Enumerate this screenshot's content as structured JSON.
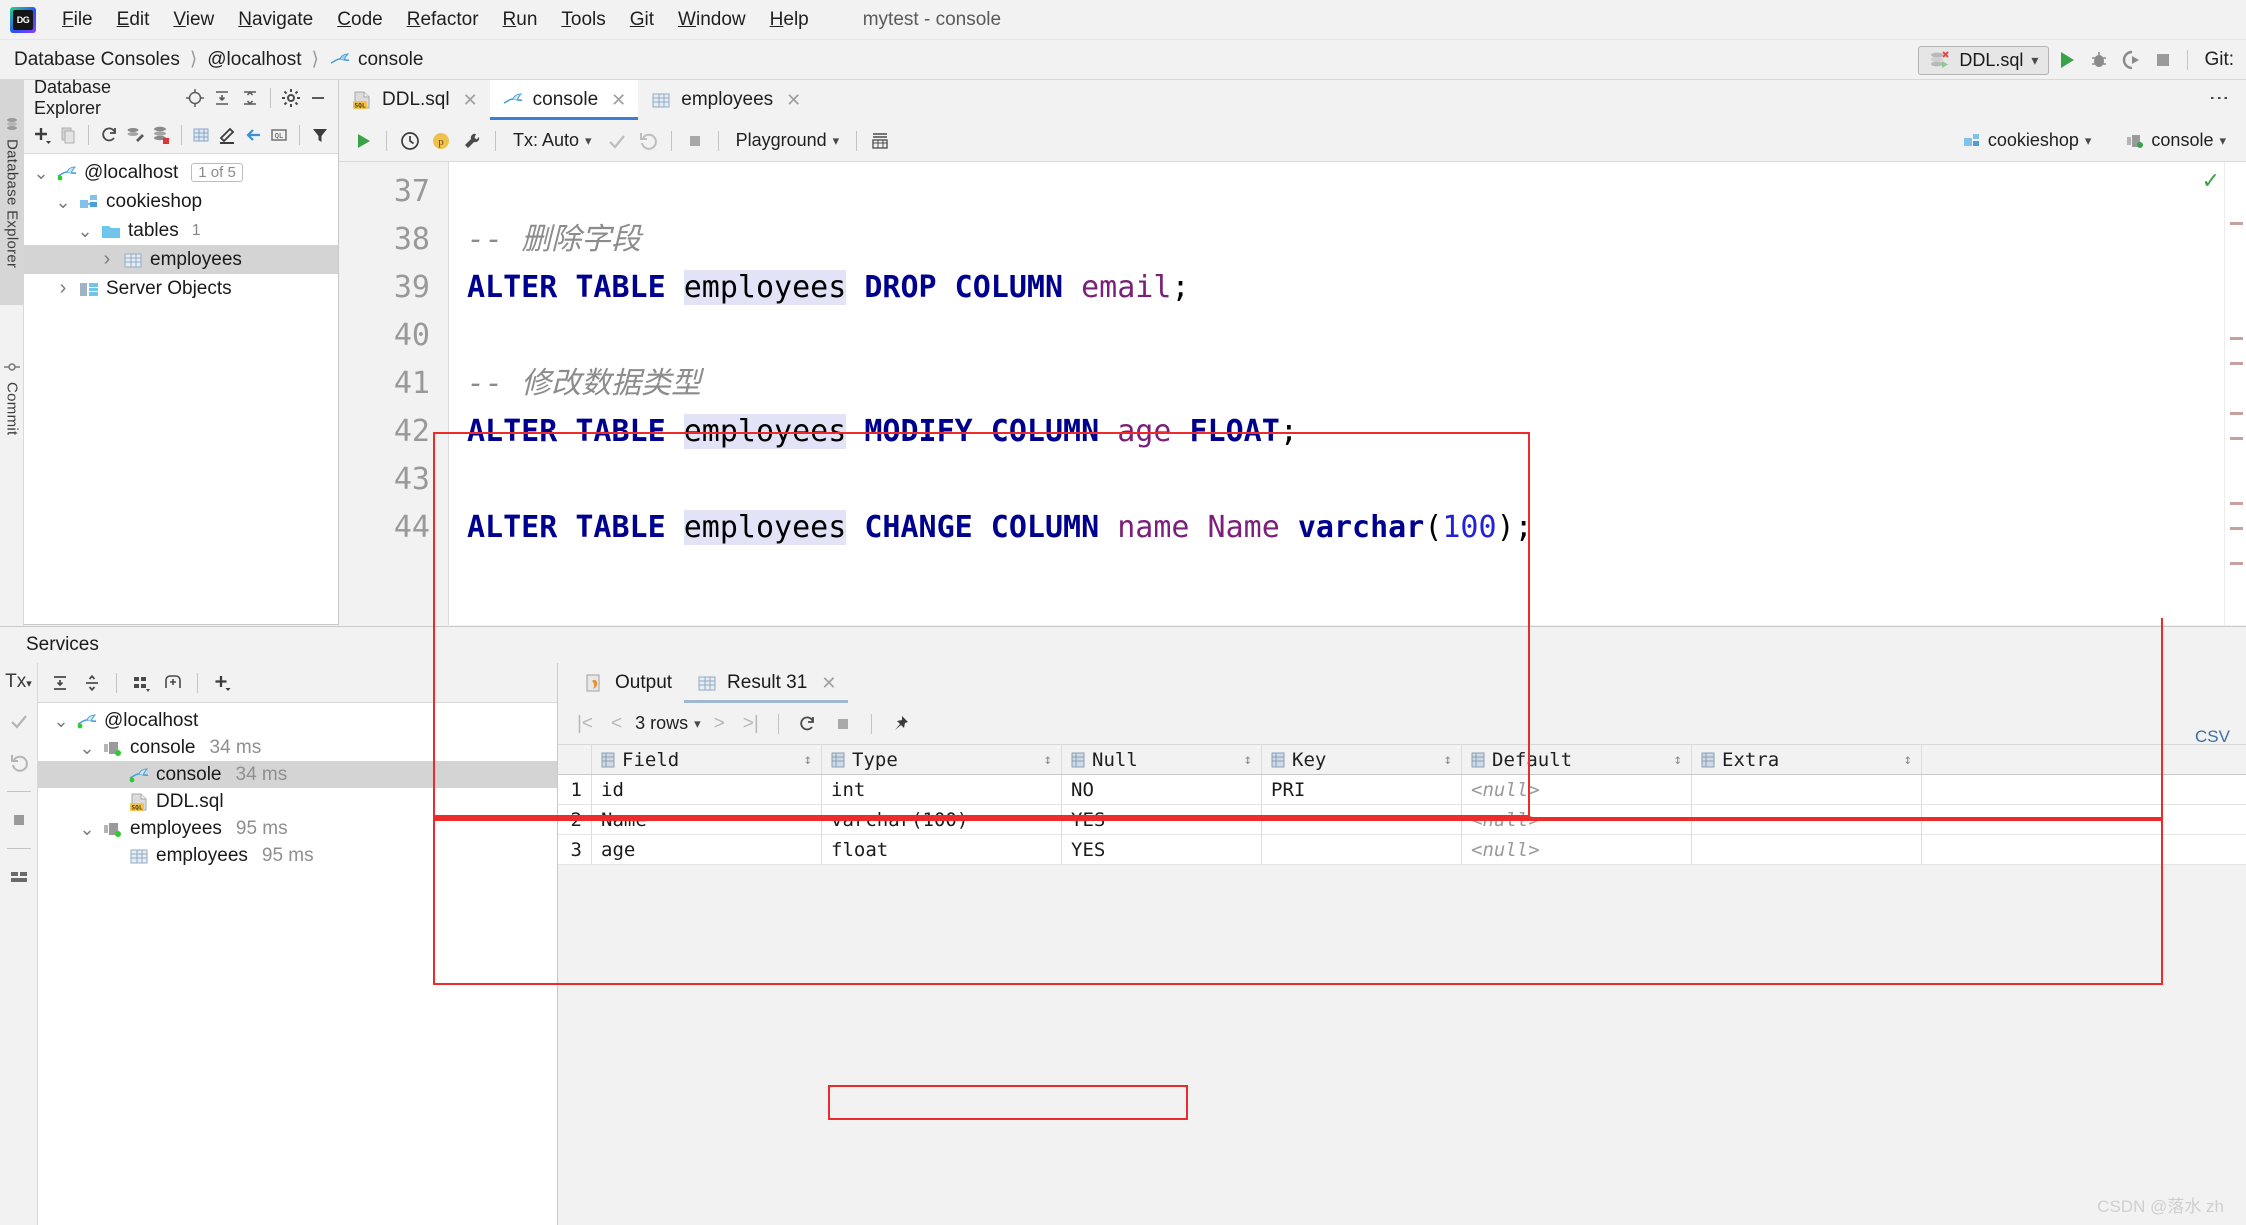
{
  "window": {
    "title": "mytest - console"
  },
  "menu": {
    "items": [
      "File",
      "Edit",
      "View",
      "Navigate",
      "Code",
      "Refactor",
      "Run",
      "Tools",
      "Git",
      "Window",
      "Help"
    ]
  },
  "breadcrumb": {
    "items": [
      "Database Consoles",
      "@localhost",
      "console"
    ]
  },
  "navbar_right": {
    "run_config": "DDL.sql",
    "git_label": "Git:",
    "icons": [
      "run-icon",
      "debug-icon",
      "run-with-coverage-icon",
      "stop-icon"
    ]
  },
  "left_strip": {
    "tabs": [
      "Database Explorer",
      "Commit"
    ]
  },
  "db_explorer": {
    "title": "Database Explorer",
    "header_icons": [
      "locate-icon",
      "expand-all-icon",
      "collapse-all-icon",
      "settings-icon",
      "hide-icon"
    ],
    "toolbar_icons": [
      "add-icon",
      "copy-icon",
      "refresh-icon",
      "modify-icon",
      "datasource-properties-icon",
      "table-editor-icon",
      "edit-icon",
      "jump-to-icon",
      "query-console-icon",
      "filter-icon"
    ],
    "tree": [
      {
        "label": "@localhost",
        "badge": "1 of 5",
        "icon": "mysql-icon",
        "depth": 0,
        "expanded": true,
        "selected": false
      },
      {
        "label": "cookieshop",
        "badge": "",
        "icon": "schema-icon",
        "depth": 1,
        "expanded": true,
        "selected": false
      },
      {
        "label": "tables",
        "badge": "",
        "count": "1",
        "icon": "folder-icon",
        "depth": 2,
        "expanded": true,
        "selected": false
      },
      {
        "label": "employees",
        "badge": "",
        "icon": "table-icon",
        "depth": 3,
        "expanded": false,
        "selected": true
      },
      {
        "label": "Server Objects",
        "badge": "",
        "icon": "server-objects-icon",
        "depth": 1,
        "expanded": false,
        "selected": false
      }
    ]
  },
  "editor": {
    "tabs": [
      {
        "label": "DDL.sql",
        "icon": "sql-file-icon",
        "active": false,
        "closable": true
      },
      {
        "label": "console",
        "icon": "mysql-console-icon",
        "active": true,
        "closable": true
      },
      {
        "label": "employees",
        "icon": "table-icon",
        "active": false,
        "closable": true
      }
    ],
    "toolbar": {
      "tx_label": "Tx: Auto",
      "schema_label": "Playground",
      "icons": [
        "execute-icon",
        "history-icon",
        "parameters-icon",
        "wrench-icon",
        "commit-icon",
        "rollback-icon",
        "stop-icon",
        "output-layout-icon"
      ]
    },
    "context": {
      "database": "cookieshop",
      "session": "console"
    },
    "gutter_lines": [
      "37",
      "38",
      "39",
      "40",
      "41",
      "42",
      "43",
      "44"
    ],
    "lines": [
      {
        "n": "37",
        "tokens": []
      },
      {
        "n": "38",
        "tokens": [
          {
            "t": "comment",
            "v": "-- 删除字段"
          }
        ]
      },
      {
        "n": "39",
        "tokens": [
          {
            "t": "kw",
            "v": "ALTER TABLE "
          },
          {
            "t": "tbl",
            "v": "employees"
          },
          {
            "t": "kw",
            "v": " DROP COLUMN "
          },
          {
            "t": "col",
            "v": "email"
          },
          {
            "t": "punc",
            "v": ";"
          }
        ]
      },
      {
        "n": "40",
        "tokens": []
      },
      {
        "n": "41",
        "tokens": [
          {
            "t": "comment",
            "v": "-- 修改数据类型"
          }
        ]
      },
      {
        "n": "42",
        "tokens": [
          {
            "t": "kw",
            "v": "ALTER TABLE "
          },
          {
            "t": "tbl",
            "v": "employees"
          },
          {
            "t": "kw",
            "v": " MODIFY COLUMN "
          },
          {
            "t": "col",
            "v": "age"
          },
          {
            "t": "kw",
            "v": " FLOAT"
          },
          {
            "t": "punc",
            "v": ";"
          }
        ]
      },
      {
        "n": "43",
        "tokens": []
      },
      {
        "n": "44",
        "tokens": [
          {
            "t": "kw",
            "v": "ALTER TABLE "
          },
          {
            "t": "tbl",
            "v": "employees"
          },
          {
            "t": "kw",
            "v": " CHANGE COLUMN "
          },
          {
            "t": "col",
            "v": "name Name"
          },
          {
            "t": "kw",
            "v": " varchar"
          },
          {
            "t": "punc",
            "v": "("
          },
          {
            "t": "num",
            "v": "100"
          },
          {
            "t": "punc",
            "v": ");"
          }
        ]
      }
    ]
  },
  "services": {
    "title": "Services",
    "strip_icons": [
      "Tx",
      "commit-icon",
      "rollback-icon",
      "stop-icon",
      "layout-icon"
    ],
    "toolbar_icons": [
      "expand-all-icon",
      "collapse-all-icon",
      "group-icon",
      "add-tab-icon",
      "add-icon"
    ],
    "tree": [
      {
        "label": "@localhost",
        "time": "",
        "icon": "mysql-icon",
        "depth": 0,
        "expanded": true,
        "selected": false
      },
      {
        "label": "console",
        "time": "34 ms",
        "icon": "session-icon",
        "depth": 1,
        "expanded": true,
        "selected": false
      },
      {
        "label": "console",
        "time": "34 ms",
        "icon": "mysql-icon",
        "depth": 2,
        "expanded": null,
        "selected": true
      },
      {
        "label": "DDL.sql",
        "time": "",
        "icon": "sql-file-icon",
        "depth": 2,
        "expanded": null,
        "selected": false
      },
      {
        "label": "employees",
        "time": "95 ms",
        "icon": "session-icon",
        "depth": 1,
        "expanded": true,
        "selected": false
      },
      {
        "label": "employees",
        "time": "95 ms",
        "icon": "table-icon",
        "depth": 2,
        "expanded": null,
        "selected": false
      }
    ]
  },
  "results": {
    "tabs": [
      {
        "label": "Output",
        "icon": "output-icon",
        "active": false,
        "closable": false
      },
      {
        "label": "Result 31",
        "icon": "table-icon",
        "active": true,
        "closable": true
      }
    ],
    "toolbar": {
      "first_page": "|<",
      "prev_page": "<",
      "rows_label": "3 rows",
      "next_page": ">",
      "last_page": ">|",
      "icons": [
        "reload-icon",
        "stop-icon",
        "pin-icon"
      ]
    },
    "export_label": "CSV",
    "columns": [
      "Field",
      "Type",
      "Null",
      "Key",
      "Default",
      "Extra"
    ],
    "rows": [
      {
        "n": "1",
        "Field": "id",
        "Type": "int",
        "Null": "NO",
        "Key": "PRI",
        "Default": "<null>",
        "Extra": ""
      },
      {
        "n": "2",
        "Field": "Name",
        "Type": "varchar(100)",
        "Null": "YES",
        "Key": "",
        "Default": "<null>",
        "Extra": ""
      },
      {
        "n": "3",
        "Field": "age",
        "Type": "float",
        "Null": "YES",
        "Key": "",
        "Default": "<null>",
        "Extra": ""
      }
    ]
  },
  "annotations": {
    "highlight_color": "#ee2b2b"
  },
  "watermark": {
    "text": "CSDN @落水 zh"
  }
}
